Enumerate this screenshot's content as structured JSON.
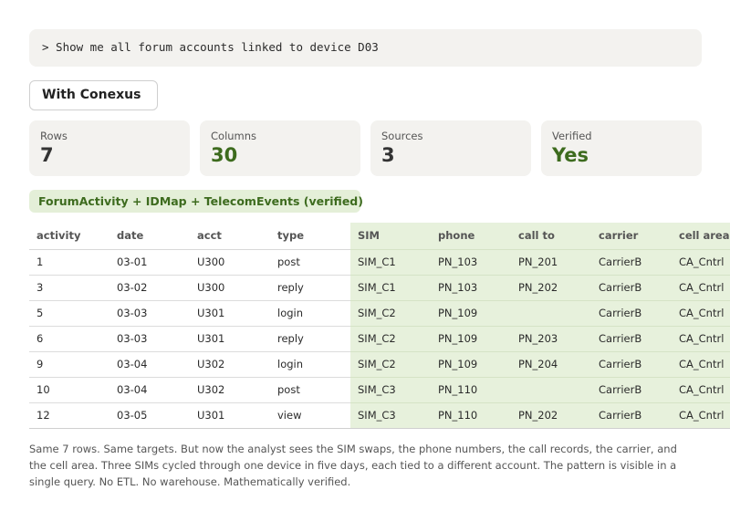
{
  "query": {
    "text": "> Show me all forum accounts linked to device D03"
  },
  "mode_button": {
    "label": "With Conexus"
  },
  "stats": [
    {
      "label": "Rows",
      "value": "7",
      "tone": "dark"
    },
    {
      "label": "Columns",
      "value": "30",
      "tone": "green"
    },
    {
      "label": "Sources",
      "value": "3",
      "tone": "dark"
    },
    {
      "label": "Verified",
      "value": "Yes",
      "tone": "green"
    }
  ],
  "source_badge": {
    "label": "ForumActivity + IDMap + TelecomEvents (verified)"
  },
  "colors": {
    "accent_green": "#3d6b1e",
    "badge_bg": "#e4efd8",
    "joined_columns_bg": "#e7f1dc",
    "card_bg": "#f3f2ef"
  },
  "table": {
    "columns": [
      "activity",
      "date",
      "acct",
      "type",
      "SIM",
      "phone",
      "call to",
      "carrier",
      "cell area"
    ],
    "rows": [
      [
        "1",
        "03-01",
        "U300",
        "post",
        "SIM_C1",
        "PN_103",
        "PN_201",
        "CarrierB",
        "CA_Cntrl"
      ],
      [
        "3",
        "03-02",
        "U300",
        "reply",
        "SIM_C1",
        "PN_103",
        "PN_202",
        "CarrierB",
        "CA_Cntrl"
      ],
      [
        "5",
        "03-03",
        "U301",
        "login",
        "SIM_C2",
        "PN_109",
        "",
        "CarrierB",
        "CA_Cntrl"
      ],
      [
        "6",
        "03-03",
        "U301",
        "reply",
        "SIM_C2",
        "PN_109",
        "PN_203",
        "CarrierB",
        "CA_Cntrl"
      ],
      [
        "9",
        "03-04",
        "U302",
        "login",
        "SIM_C2",
        "PN_109",
        "PN_204",
        "CarrierB",
        "CA_Cntrl"
      ],
      [
        "10",
        "03-04",
        "U302",
        "post",
        "SIM_C3",
        "PN_110",
        "",
        "CarrierB",
        "CA_Cntrl"
      ],
      [
        "12",
        "03-05",
        "U301",
        "view",
        "SIM_C3",
        "PN_110",
        "PN_202",
        "CarrierB",
        "CA_Cntrl"
      ]
    ]
  },
  "caption": {
    "text": "Same 7 rows. Same targets. But now the analyst sees the SIM swaps, the phone numbers, the call records, the carrier, and the cell area. Three SIMs cycled through one device in five days, each tied to a different account. The pattern is visible in a single query. No ETL. No warehouse. Mathematically verified."
  }
}
